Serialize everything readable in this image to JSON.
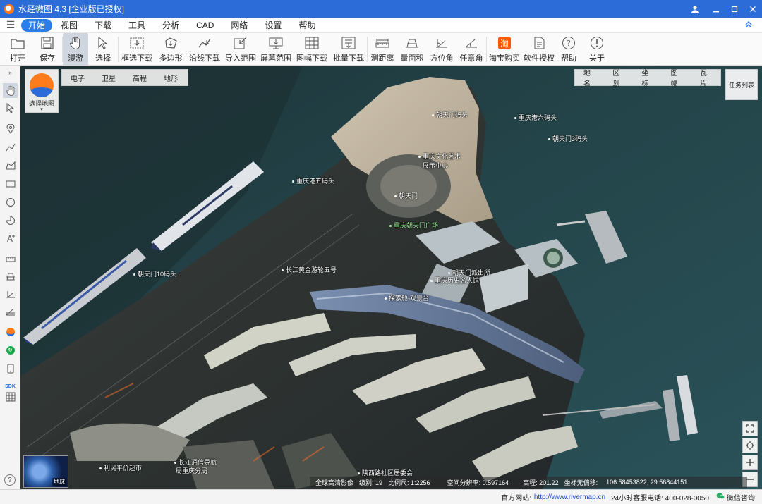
{
  "window": {
    "title": "水经微图 4.3 [企业版已授权]"
  },
  "menu": {
    "items": [
      "开始",
      "视图",
      "下载",
      "工具",
      "分析",
      "CAD",
      "网络",
      "设置",
      "帮助"
    ]
  },
  "toolbar": {
    "open": "打开",
    "save": "保存",
    "roam": "漫游",
    "select": "选择",
    "box_download": "框选下载",
    "polygon": "多边形",
    "line_download": "沿线下载",
    "import_range": "导入范围",
    "screen_range": "屏幕范围",
    "sheet_download": "图幅下载",
    "batch_download": "批量下载",
    "measure_distance": "测距离",
    "measure_area": "量面积",
    "azimuth": "方位角",
    "arbitrary_angle": "任意角",
    "taobao_buy": "淘宝购买",
    "software_license": "软件授权",
    "help": "帮助",
    "about": "关于",
    "taobao_icon_text": "淘"
  },
  "map": {
    "selector_label": "选择地图",
    "map_types": [
      "电子",
      "卫星",
      "高程",
      "地形"
    ],
    "layers": [
      "地名",
      "区划",
      "坐标",
      "图幅",
      "瓦片"
    ],
    "task_list": "任务列表",
    "globe_label": "地球",
    "labels": [
      {
        "id": "l1",
        "text": "朝天门码头"
      },
      {
        "id": "l2",
        "text": "重庆港六码头"
      },
      {
        "id": "l3",
        "text": "朝天门3码头"
      },
      {
        "id": "l4",
        "text": "重庆文化艺术"
      },
      {
        "id": "l5",
        "text": "展示中心"
      },
      {
        "id": "l6",
        "text": "重庆港五码头"
      },
      {
        "id": "l7",
        "text": "朝天门"
      },
      {
        "id": "l8",
        "text": "重庆朝天门广场"
      },
      {
        "id": "l9",
        "text": "朝天门10码头"
      },
      {
        "id": "l10",
        "text": "长江黄金游轮五号"
      },
      {
        "id": "l11",
        "text": "朝天门派出所"
      },
      {
        "id": "l12",
        "text": "重庆历史名人馆"
      },
      {
        "id": "l13",
        "text": "探索舱·观景台"
      },
      {
        "id": "l14",
        "text": "利民平价超市"
      },
      {
        "id": "l15",
        "text": "长江通信导航"
      },
      {
        "id": "l16",
        "text": "局重庆分局"
      },
      {
        "id": "l17",
        "text": "陕西路社区居委会"
      }
    ]
  },
  "map_status": {
    "source": "全球高清影像",
    "level": "级别:  19",
    "scale": "比例尺: 1:2256",
    "resolution": "空间分辨率: 0.597164",
    "elevation": "高程:   201.22",
    "offset": "坐标无偏移:",
    "coords": "106.58453822, 29.56844151"
  },
  "statusbar": {
    "site_label": "官方网站:",
    "site_url": "http://www.rivermap.cn",
    "hotline": "24小时客服电话: 400-028-0050",
    "wechat": "微信咨询"
  },
  "colors": {
    "titlebar": "#2b6cd8",
    "accent": "#2b7de9",
    "water": "#213b3f"
  }
}
